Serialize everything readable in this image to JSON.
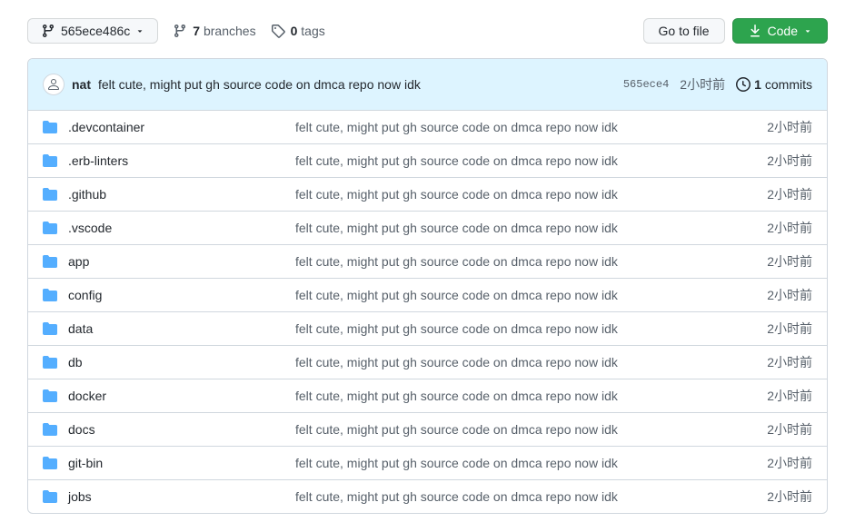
{
  "toolbar": {
    "branch": "565ece486c",
    "branches_count": "7",
    "branches_label": "branches",
    "tags_count": "0",
    "tags_label": "tags",
    "go_to_file": "Go to file",
    "code": "Code"
  },
  "commit": {
    "author": "nat",
    "message": "felt cute, might put gh source code on dmca repo now idk",
    "sha": "565ece4",
    "time": "2小时前",
    "commits_count": "1",
    "commits_label": "commits"
  },
  "files": [
    {
      "name": ".devcontainer",
      "msg": "felt cute, might put gh source code on dmca repo now idk",
      "time": "2小时前"
    },
    {
      "name": ".erb-linters",
      "msg": "felt cute, might put gh source code on dmca repo now idk",
      "time": "2小时前"
    },
    {
      "name": ".github",
      "msg": "felt cute, might put gh source code on dmca repo now idk",
      "time": "2小时前"
    },
    {
      "name": ".vscode",
      "msg": "felt cute, might put gh source code on dmca repo now idk",
      "time": "2小时前"
    },
    {
      "name": "app",
      "msg": "felt cute, might put gh source code on dmca repo now idk",
      "time": "2小时前"
    },
    {
      "name": "config",
      "msg": "felt cute, might put gh source code on dmca repo now idk",
      "time": "2小时前"
    },
    {
      "name": "data",
      "msg": "felt cute, might put gh source code on dmca repo now idk",
      "time": "2小时前"
    },
    {
      "name": "db",
      "msg": "felt cute, might put gh source code on dmca repo now idk",
      "time": "2小时前"
    },
    {
      "name": "docker",
      "msg": "felt cute, might put gh source code on dmca repo now idk",
      "time": "2小时前"
    },
    {
      "name": "docs",
      "msg": "felt cute, might put gh source code on dmca repo now idk",
      "time": "2小时前"
    },
    {
      "name": "git-bin",
      "msg": "felt cute, might put gh source code on dmca repo now idk",
      "time": "2小时前"
    },
    {
      "name": "jobs",
      "msg": "felt cute, might put gh source code on dmca repo now idk",
      "time": "2小时前"
    }
  ]
}
